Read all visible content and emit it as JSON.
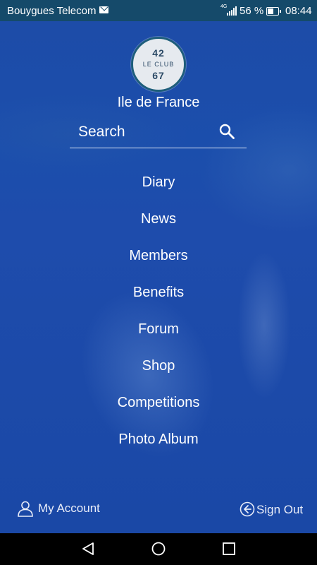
{
  "status_bar": {
    "carrier": "Bouygues Telecom",
    "network": "4G",
    "battery": "56 %",
    "time": "08:44"
  },
  "logo": {
    "top_number": "42",
    "middle_text": "LE CLUB",
    "bottom_number": "67"
  },
  "region": "Ile de France",
  "search": {
    "placeholder": "Search"
  },
  "menu": {
    "items": [
      {
        "label": "Diary"
      },
      {
        "label": "News"
      },
      {
        "label": "Members"
      },
      {
        "label": "Benefits"
      },
      {
        "label": "Forum"
      },
      {
        "label": "Shop"
      },
      {
        "label": "Competitions"
      },
      {
        "label": "Photo Album"
      }
    ]
  },
  "footer": {
    "account_label": "My Account",
    "signout_label": "Sign Out"
  },
  "icons": {
    "mail": "mail-icon",
    "signal": "signal-icon",
    "battery": "battery-icon",
    "search": "search-icon",
    "user": "user-icon",
    "signout": "signout-icon",
    "back": "back-icon",
    "home": "home-icon",
    "recents": "recents-icon"
  },
  "colors": {
    "status_bar": "#154a6a",
    "background": "#1a46a8",
    "text": "#ffffff",
    "nav_bar": "#000000"
  }
}
